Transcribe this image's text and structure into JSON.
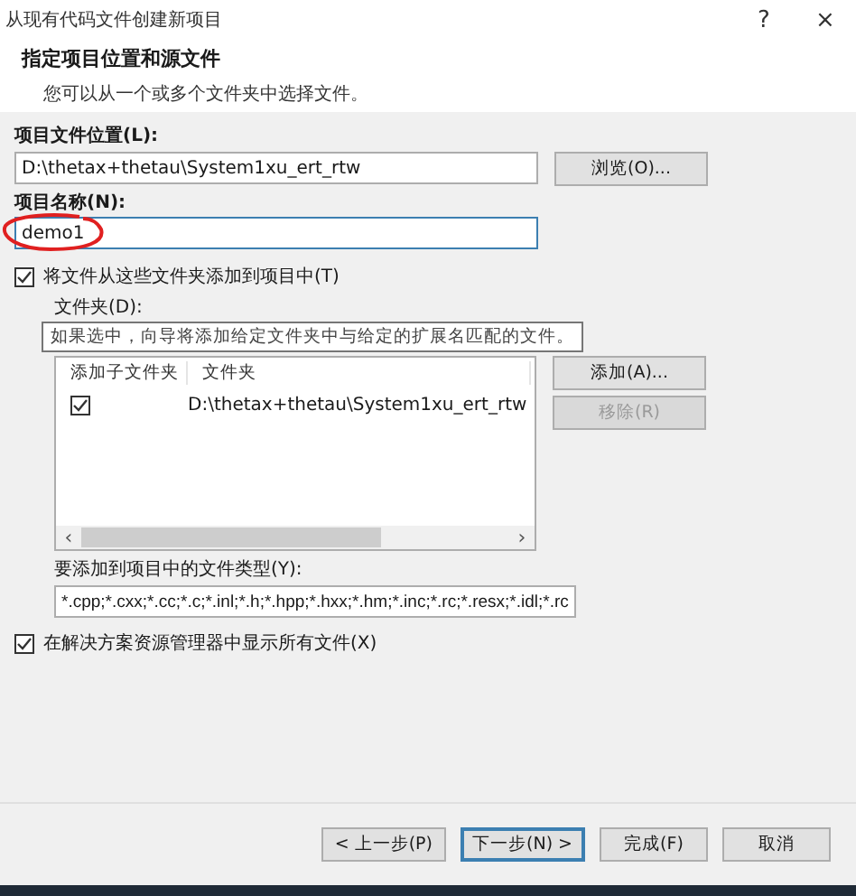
{
  "window": {
    "title": "从现有代码文件创建新项目",
    "help": "?",
    "close": "×"
  },
  "header": {
    "title": "指定项目位置和源文件",
    "subtitle": "您可以从一个或多个文件夹中选择文件。"
  },
  "location": {
    "label": "项目文件位置(L):",
    "value": "D:\\thetax+thetau\\System1xu_ert_rtw",
    "browse": "浏览(O)..."
  },
  "name": {
    "label": "项目名称(N):",
    "value": "demo1",
    "focused": true,
    "circled": true
  },
  "add_folders": {
    "label": "将文件从这些文件夹添加到项目中(T)",
    "checked": true
  },
  "folders": {
    "label": "文件夹(D):",
    "tooltip": "如果选中，向导将添加给定文件夹中与给定的扩展名匹配的文件。",
    "columns": [
      "添加子文件夹",
      "文件夹"
    ],
    "rows": [
      {
        "checked": true,
        "path": "D:\\thetax+thetau\\System1xu_ert_rtw"
      }
    ],
    "scroll_left": "‹",
    "scroll_right": "›",
    "add": {
      "label": "添加(A)...",
      "disabled": false
    },
    "remove": {
      "label": "移除(R)",
      "disabled": true
    }
  },
  "types": {
    "label": "要添加到项目中的文件类型(Y):",
    "value": "*.cpp;*.cxx;*.cc;*.c;*.inl;*.h;*.hpp;*.hxx;*.hm;*.inc;*.rc;*.resx;*.idl;*.rc"
  },
  "show_all": {
    "label": "在解决方案资源管理器中显示所有文件(X)",
    "checked": true
  },
  "buttons": [
    {
      "label": "< 上一步(P)",
      "focused": false
    },
    {
      "label": "下一步(N) >",
      "focused": true
    },
    {
      "label": "完成(F)",
      "focused": false
    },
    {
      "label": "取消",
      "focused": false
    }
  ]
}
